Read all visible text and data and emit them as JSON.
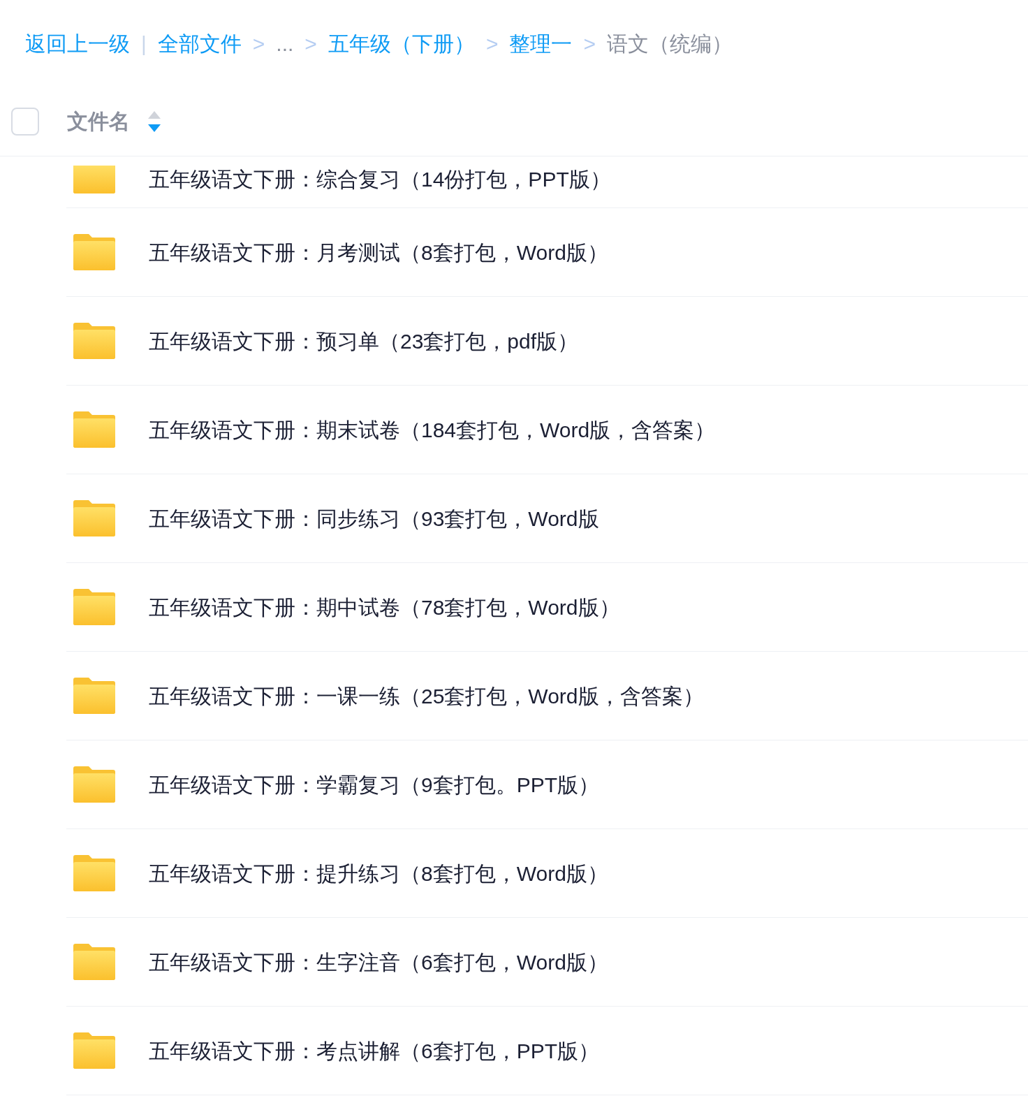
{
  "breadcrumb": [
    {
      "kind": "link",
      "label": "返回上一级"
    },
    {
      "kind": "divider",
      "label": "|"
    },
    {
      "kind": "link",
      "label": "全部文件"
    },
    {
      "kind": "sep",
      "label": ">"
    },
    {
      "kind": "ellipsis",
      "label": "..."
    },
    {
      "kind": "sep",
      "label": ">"
    },
    {
      "kind": "link",
      "label": "五年级（下册）"
    },
    {
      "kind": "sep",
      "label": ">"
    },
    {
      "kind": "link",
      "label": "整理一"
    },
    {
      "kind": "sep",
      "label": ">"
    },
    {
      "kind": "current",
      "label": "语文（统编）"
    }
  ],
  "header": {
    "checked": false,
    "column": "文件名",
    "sort_descending": true
  },
  "files": [
    {
      "name": "五年级语文下册：综合复习（14份打包，PPT版）",
      "partial": true
    },
    {
      "name": "五年级语文下册：月考测试（8套打包，Word版）",
      "partial": false
    },
    {
      "name": "五年级语文下册：预习单（23套打包，pdf版）",
      "partial": false
    },
    {
      "name": "五年级语文下册：期末试卷（184套打包，Word版，含答案）",
      "partial": false
    },
    {
      "name": "五年级语文下册：同步练习（93套打包，Word版",
      "partial": false
    },
    {
      "name": "五年级语文下册：期中试卷（78套打包，Word版）",
      "partial": false
    },
    {
      "name": "五年级语文下册：一课一练（25套打包，Word版，含答案）",
      "partial": false
    },
    {
      "name": "五年级语文下册：学霸复习（9套打包。PPT版）",
      "partial": false
    },
    {
      "name": "五年级语文下册：提升练习（8套打包，Word版）",
      "partial": false
    },
    {
      "name": "五年级语文下册：生字注音（6套打包，Word版）",
      "partial": false
    },
    {
      "name": "五年级语文下册：考点讲解（6套打包，PPT版）",
      "partial": false
    }
  ]
}
